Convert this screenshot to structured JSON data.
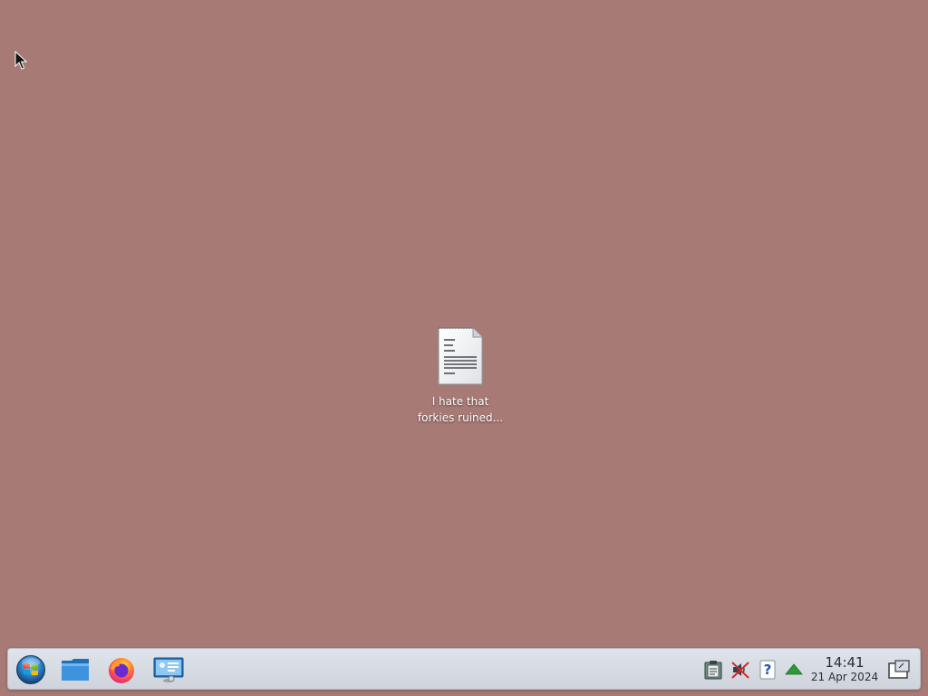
{
  "desktop": {
    "background_color": "#a77a76",
    "icons": [
      {
        "label_line1": "I hate that",
        "label_line2": "forkies ruined...",
        "icon": "text-document-icon"
      }
    ]
  },
  "taskbar": {
    "launchers": [
      {
        "name": "start-menu",
        "icon": "windows-orb-icon"
      },
      {
        "name": "file-manager",
        "icon": "folder-icon"
      },
      {
        "name": "firefox",
        "icon": "firefox-icon"
      },
      {
        "name": "system-settings",
        "icon": "control-panel-icon"
      }
    ],
    "tray": [
      {
        "name": "clipboard",
        "icon": "clipboard-icon"
      },
      {
        "name": "audio-muted",
        "icon": "speaker-muted-icon"
      },
      {
        "name": "help",
        "icon": "help-icon",
        "glyph": "?"
      },
      {
        "name": "updates",
        "icon": "arrow-up-icon"
      }
    ],
    "clock": {
      "time": "14:41",
      "date": "21 Apr 2024"
    },
    "show_desktop": {
      "icon": "show-desktop-icon"
    }
  }
}
